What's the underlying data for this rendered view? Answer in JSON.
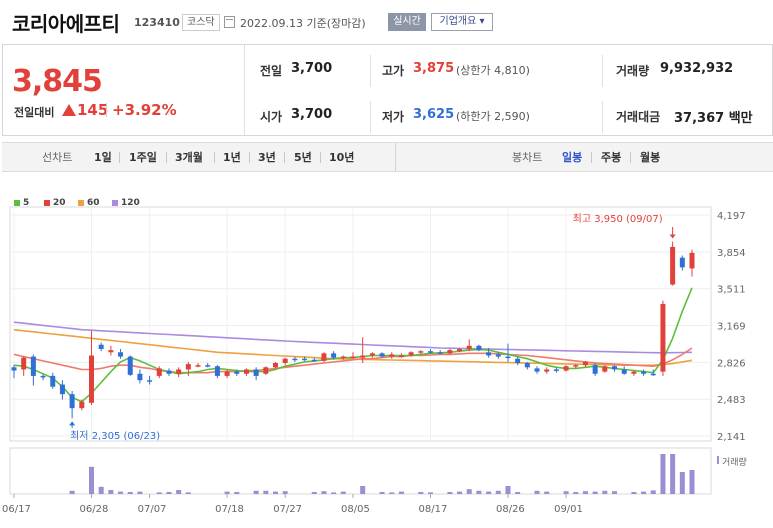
{
  "header": {
    "company_name": "코리아에프티",
    "stock_code": "123410",
    "market_badge": "코스닥",
    "date": "2022.09.13",
    "basis": "기준(장마감)",
    "realtime_label": "실시간",
    "company_info_label": "기업개요 ▾"
  },
  "quote": {
    "price": "3,845",
    "change_label": "전일대비",
    "change": "145",
    "change_pct": "+3.92%",
    "prev_close_label": "전일",
    "prev_close": "3,700",
    "open_label": "시가",
    "open": "3,700",
    "high_label": "고가",
    "high": "3,875",
    "upper_limit": "(상한가 4,810)",
    "low_label": "저가",
    "low": "3,625",
    "lower_limit": "(하한가 2,590)",
    "volume_label": "거래량",
    "volume": "9,932,932",
    "turnover_label": "거래대금",
    "turnover": "37,367 백만"
  },
  "period_bar": {
    "line_chart_label": "선차트",
    "periods": [
      "1일",
      "1주일",
      "3개월",
      "1년",
      "3년",
      "5년",
      "10년"
    ],
    "candle_chart_label": "봉차트",
    "candle_periods": [
      "일봉",
      "주봉",
      "월봉"
    ],
    "selected_candle_period": "일봉"
  },
  "colors": {
    "up": "#e2403a",
    "down": "#2f6fd6",
    "ma5": "#5cbf3c",
    "ma20": "#f07a6e",
    "ma60": "#f0a040",
    "ma120": "#a98be0",
    "volume": "#9b8ed4"
  },
  "chart_data": {
    "type": "candlestick",
    "legend": [
      "5",
      "20",
      "60",
      "120"
    ],
    "y_ticks": [
      "4,197",
      "3,854",
      "3,511",
      "3,169",
      "2,826",
      "2,483",
      "2,141"
    ],
    "ylim": [
      2141,
      4197
    ],
    "x_ticks": [
      "06/17",
      "06/28",
      "07/07",
      "07/18",
      "07/27",
      "08/05",
      "08/17",
      "08/26",
      "09/01"
    ],
    "high_annotation": "최고 3,950 (09/07)",
    "low_annotation": "최저 2,305 (06/23)",
    "volume_label": "거래량",
    "candles": [
      [
        2780,
        2800,
        2680,
        2750
      ],
      [
        2760,
        2880,
        2700,
        2870
      ],
      [
        2880,
        2900,
        2610,
        2700
      ],
      [
        2700,
        2720,
        2660,
        2690
      ],
      [
        2700,
        2730,
        2580,
        2600
      ],
      [
        2620,
        2660,
        2480,
        2530
      ],
      [
        2530,
        2560,
        2305,
        2400
      ],
      [
        2400,
        2480,
        2380,
        2460
      ],
      [
        2450,
        3120,
        2430,
        2890
      ],
      [
        2990,
        3010,
        2930,
        2950
      ],
      [
        2920,
        2980,
        2890,
        2940
      ],
      [
        2920,
        2950,
        2860,
        2880
      ],
      [
        2880,
        2890,
        2700,
        2710
      ],
      [
        2720,
        2760,
        2630,
        2660
      ],
      [
        2660,
        2700,
        2620,
        2650
      ],
      [
        2700,
        2790,
        2680,
        2770
      ],
      [
        2750,
        2770,
        2700,
        2720
      ],
      [
        2720,
        2780,
        2690,
        2760
      ],
      [
        2760,
        2830,
        2700,
        2810
      ],
      [
        2800,
        2820,
        2780,
        2800
      ],
      [
        2800,
        2820,
        2780,
        2790
      ],
      [
        2790,
        2800,
        2680,
        2700
      ],
      [
        2700,
        2760,
        2680,
        2740
      ],
      [
        2740,
        2760,
        2700,
        2720
      ],
      [
        2720,
        2770,
        2700,
        2760
      ],
      [
        2760,
        2780,
        2660,
        2700
      ],
      [
        2720,
        2790,
        2710,
        2780
      ],
      [
        2780,
        2830,
        2770,
        2820
      ],
      [
        2820,
        2870,
        2800,
        2860
      ],
      [
        2860,
        2880,
        2830,
        2850
      ],
      [
        2860,
        2880,
        2840,
        2850
      ],
      [
        2850,
        2870,
        2830,
        2840
      ],
      [
        2840,
        2920,
        2830,
        2910
      ],
      [
        2910,
        2930,
        2850,
        2870
      ],
      [
        2870,
        2890,
        2850,
        2880
      ],
      [
        2880,
        2920,
        2860,
        2880
      ],
      [
        2870,
        3060,
        2820,
        2890
      ],
      [
        2890,
        2920,
        2870,
        2910
      ],
      [
        2910,
        2920,
        2870,
        2880
      ],
      [
        2880,
        2920,
        2860,
        2900
      ],
      [
        2890,
        2910,
        2870,
        2890
      ],
      [
        2890,
        2930,
        2880,
        2920
      ],
      [
        2920,
        2940,
        2900,
        2930
      ],
      [
        2930,
        2950,
        2910,
        2920
      ],
      [
        2920,
        2940,
        2900,
        2910
      ],
      [
        2910,
        2950,
        2900,
        2940
      ],
      [
        2930,
        2960,
        2920,
        2950
      ],
      [
        2950,
        3040,
        2930,
        2980
      ],
      [
        2980,
        2990,
        2930,
        2940
      ],
      [
        2920,
        2960,
        2870,
        2890
      ],
      [
        2900,
        2920,
        2860,
        2880
      ],
      [
        2880,
        3000,
        2830,
        2870
      ],
      [
        2860,
        2880,
        2800,
        2820
      ],
      [
        2820,
        2830,
        2760,
        2780
      ],
      [
        2770,
        2790,
        2720,
        2740
      ],
      [
        2740,
        2780,
        2720,
        2760
      ],
      [
        2760,
        2780,
        2730,
        2750
      ],
      [
        2750,
        2800,
        2740,
        2790
      ],
      [
        2790,
        2810,
        2770,
        2800
      ],
      [
        2800,
        2840,
        2780,
        2830
      ],
      [
        2800,
        2820,
        2700,
        2720
      ],
      [
        2740,
        2800,
        2730,
        2790
      ],
      [
        2790,
        2800,
        2740,
        2760
      ],
      [
        2760,
        2790,
        2710,
        2720
      ],
      [
        2720,
        2750,
        2700,
        2740
      ],
      [
        2740,
        2760,
        2700,
        2720
      ],
      [
        2720,
        2760,
        2700,
        2710
      ],
      [
        2740,
        3400,
        2700,
        3370
      ],
      [
        3550,
        3950,
        3540,
        3900
      ],
      [
        3800,
        3820,
        3680,
        3710
      ],
      [
        3700,
        3875,
        3625,
        3845
      ]
    ],
    "volumes": [
      0,
      0,
      0,
      0,
      0,
      0,
      0.08,
      0,
      0.68,
      0.18,
      0.1,
      0.06,
      0.05,
      0.06,
      0,
      0.04,
      0.05,
      0.1,
      0.04,
      0,
      0,
      0,
      0.06,
      0.05,
      0,
      0.08,
      0.08,
      0.06,
      0.07,
      0,
      0,
      0.05,
      0.07,
      0.04,
      0.06,
      0,
      0.2,
      0,
      0.05,
      0.04,
      0.06,
      0,
      0.05,
      0.04,
      0,
      0.05,
      0.06,
      0.12,
      0.08,
      0.06,
      0.08,
      0.2,
      0.05,
      0,
      0.08,
      0.06,
      0,
      0.07,
      0.05,
      0.07,
      0.06,
      0.08,
      0.07,
      0,
      0.05,
      0.06,
      0.09,
      1.0,
      1.0,
      0.55,
      0.6
    ],
    "ma5": [
      2800,
      2790,
      2760,
      2720,
      2680,
      2600,
      2500,
      2460,
      2540,
      2640,
      2740,
      2830,
      2870,
      2840,
      2800,
      2760,
      2740,
      2720,
      2730,
      2740,
      2760,
      2770,
      2760,
      2750,
      2740,
      2740,
      2740,
      2760,
      2790,
      2810,
      2830,
      2840,
      2850,
      2860,
      2870,
      2870,
      2880,
      2890,
      2890,
      2890,
      2890,
      2890,
      2900,
      2910,
      2915,
      2920,
      2930,
      2940,
      2945,
      2940,
      2920,
      2900,
      2880,
      2860,
      2830,
      2800,
      2780,
      2770,
      2770,
      2780,
      2790,
      2780,
      2770,
      2760,
      2750,
      2740,
      2730,
      2850,
      3050,
      3300,
      3520
    ],
    "ma20": [
      2900,
      2880,
      2860,
      2840,
      2820,
      2800,
      2780,
      2760,
      2760,
      2770,
      2790,
      2800,
      2800,
      2780,
      2770,
      2750,
      2740,
      2730,
      2730,
      2730,
      2730,
      2740,
      2740,
      2740,
      2750,
      2750,
      2760,
      2770,
      2780,
      2790,
      2800,
      2810,
      2820,
      2830,
      2840,
      2850,
      2860,
      2860,
      2870,
      2880,
      2880,
      2890,
      2890,
      2895,
      2900,
      2900,
      2905,
      2910,
      2910,
      2910,
      2905,
      2900,
      2895,
      2890,
      2880,
      2870,
      2860,
      2850,
      2840,
      2830,
      2820,
      2815,
      2810,
      2805,
      2800,
      2795,
      2790,
      2810,
      2850,
      2900,
      2960
    ],
    "ma60": [
      3130,
      3120,
      3110,
      3100,
      3090,
      3080,
      3070,
      3060,
      3050,
      3040,
      3030,
      3020,
      3010,
      3000,
      2990,
      2980,
      2970,
      2960,
      2950,
      2940,
      2930,
      2920,
      2915,
      2910,
      2905,
      2900,
      2895,
      2890,
      2885,
      2880,
      2875,
      2870,
      2865,
      2860,
      2858,
      2856,
      2854,
      2852,
      2850,
      2848,
      2846,
      2844,
      2842,
      2840,
      2838,
      2836,
      2834,
      2832,
      2830,
      2828,
      2826,
      2824,
      2822,
      2820,
      2818,
      2816,
      2814,
      2812,
      2810,
      2808,
      2806,
      2804,
      2802,
      2800,
      2800,
      2800,
      2800,
      2805,
      2815,
      2830,
      2845
    ],
    "ma120": [
      3200,
      3190,
      3180,
      3170,
      3160,
      3150,
      3140,
      3130,
      3125,
      3120,
      3115,
      3110,
      3105,
      3100,
      3095,
      3090,
      3085,
      3080,
      3075,
      3070,
      3065,
      3060,
      3055,
      3050,
      3045,
      3040,
      3035,
      3030,
      3025,
      3020,
      3016,
      3012,
      3008,
      3004,
      3000,
      2996,
      2992,
      2988,
      2984,
      2980,
      2976,
      2972,
      2968,
      2964,
      2960,
      2958,
      2956,
      2954,
      2952,
      2950,
      2948,
      2946,
      2944,
      2942,
      2940,
      2938,
      2936,
      2934,
      2932,
      2930,
      2928,
      2926,
      2924,
      2922,
      2920,
      2918,
      2916,
      2915,
      2916,
      2918,
      2920
    ]
  }
}
